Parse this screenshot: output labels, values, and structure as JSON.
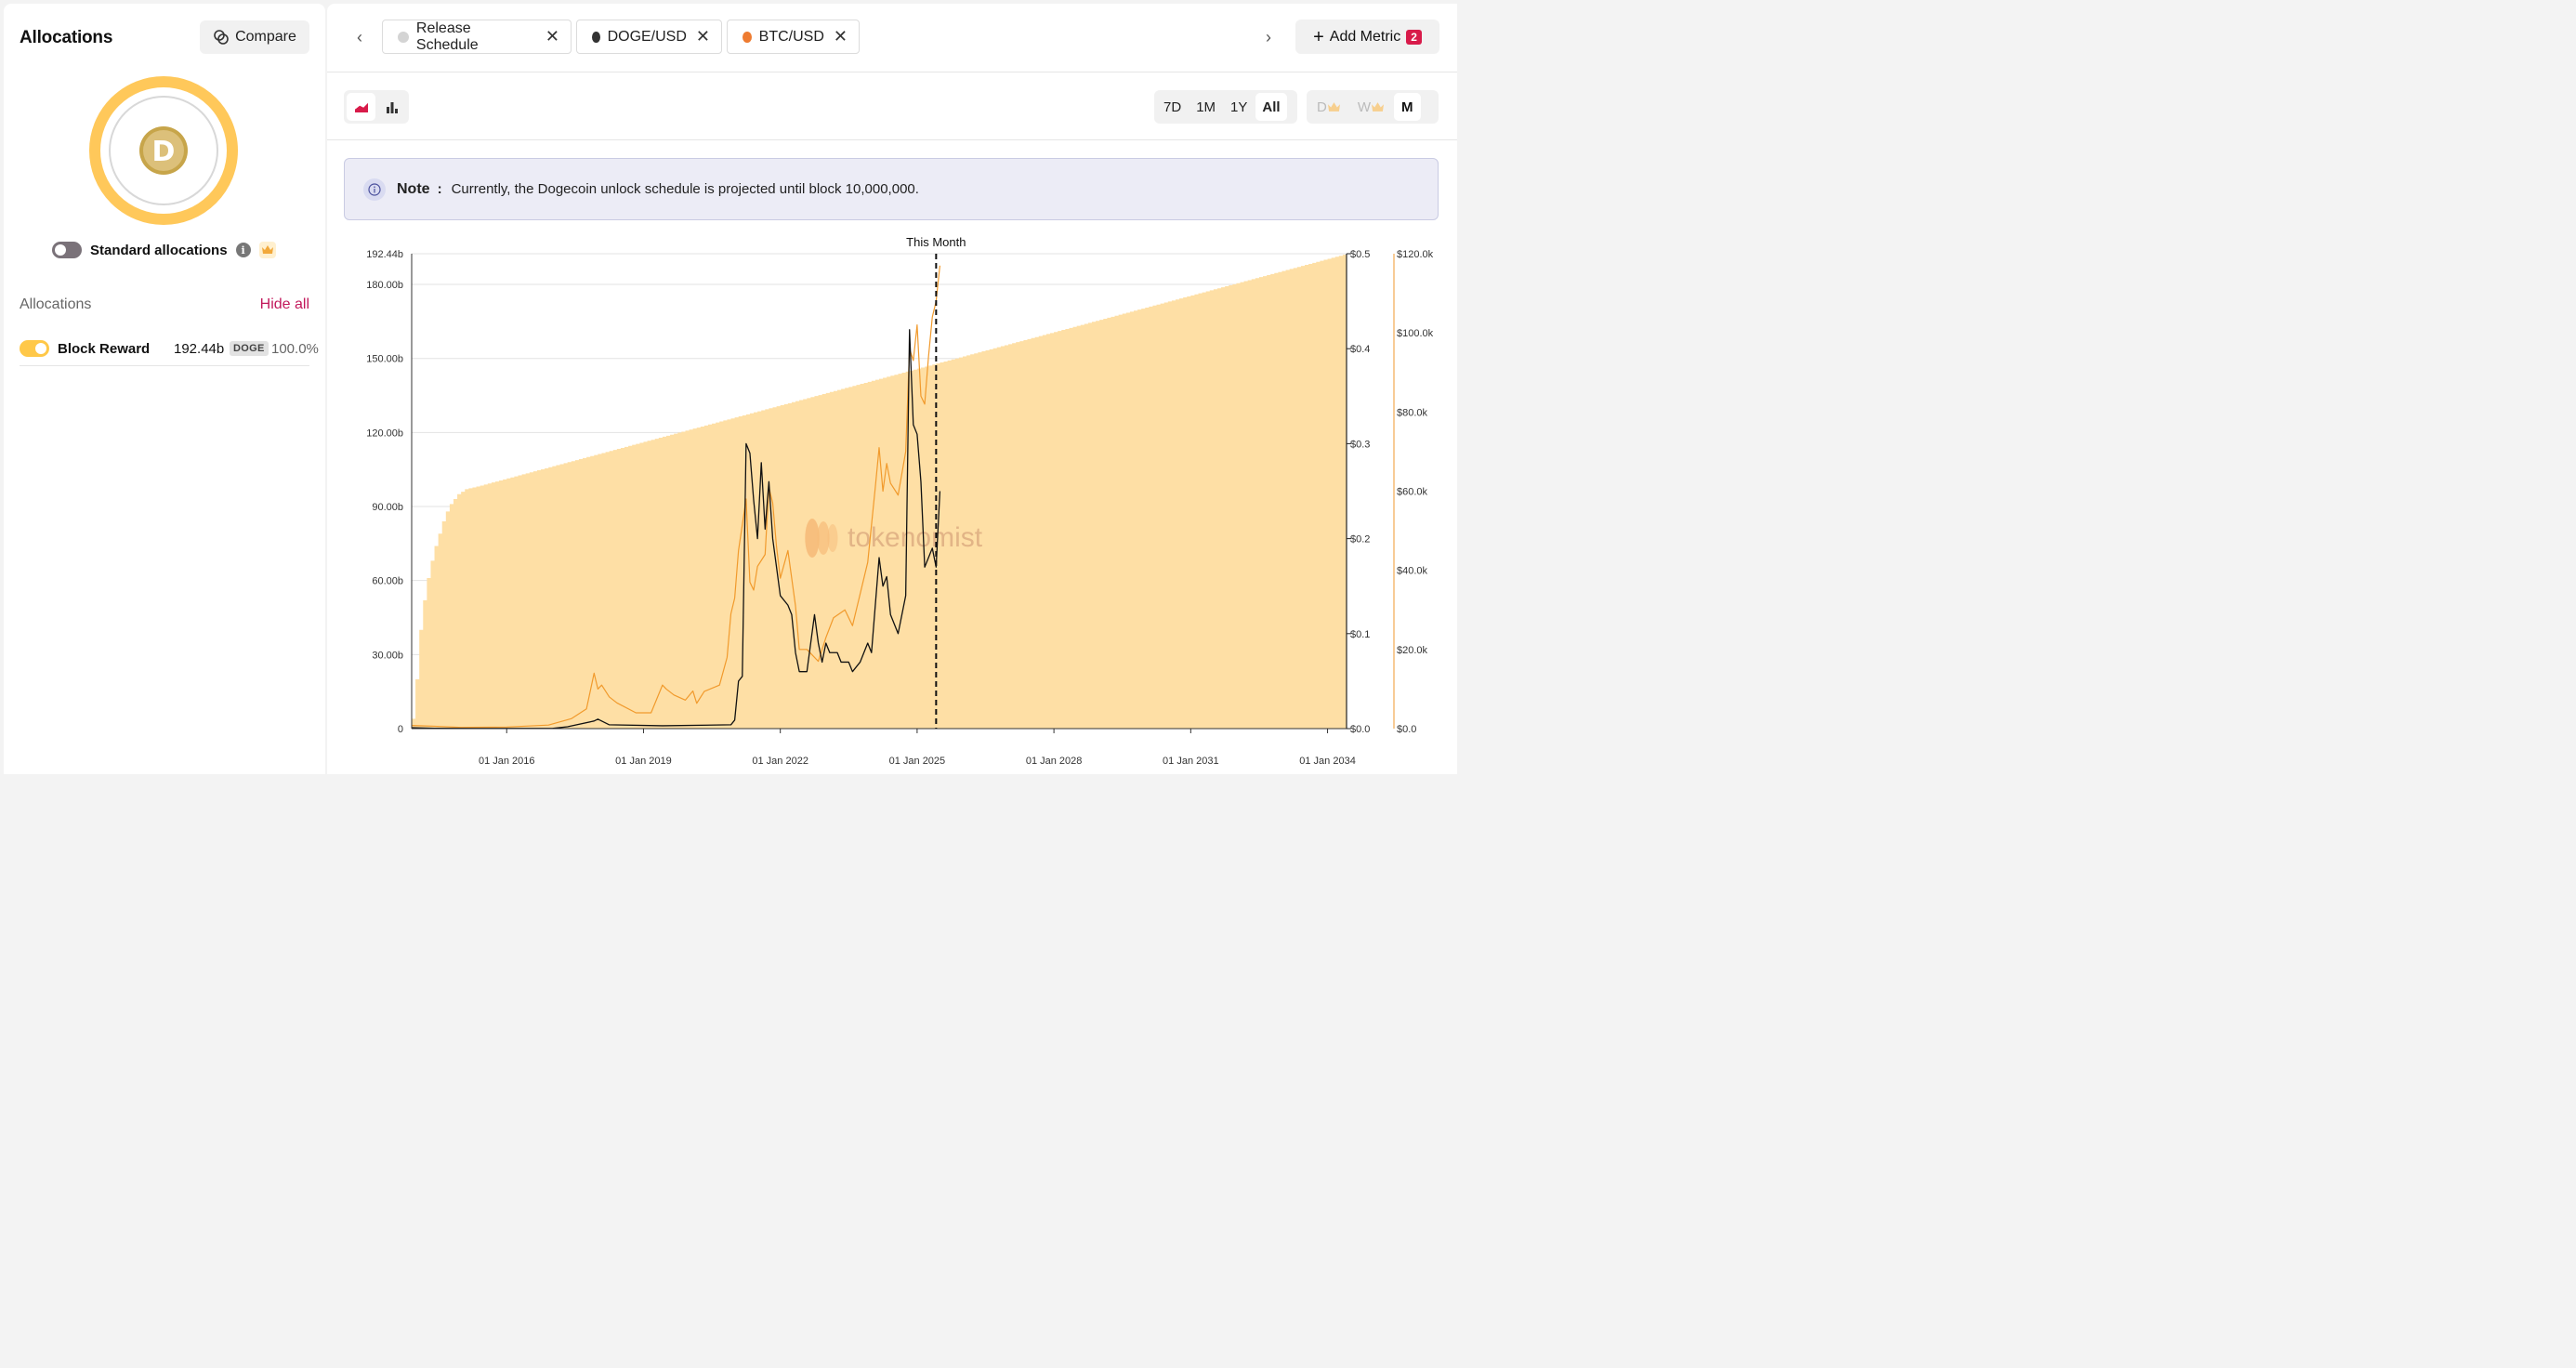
{
  "sidebar": {
    "title": "Allocations",
    "compare_label": "Compare",
    "token_logo_letter": "D",
    "standard_allocations_label": "Standard allocations",
    "allocations_label": "Allocations",
    "hide_all_label": "Hide all",
    "items": [
      {
        "name": "Block Reward",
        "amount": "192.44b",
        "symbol": "DOGE",
        "percent": "100.0%",
        "enabled": true
      }
    ]
  },
  "tabs": [
    {
      "label": "Release Schedule",
      "color": "#d4d4d4"
    },
    {
      "label": "DOGE/USD",
      "color": "#333333"
    },
    {
      "label": "BTC/USD",
      "color": "#ee7b30"
    }
  ],
  "add_metric": {
    "label": "Add Metric",
    "count": "2"
  },
  "ranges": [
    "7D",
    "1M",
    "1Y",
    "All"
  ],
  "active_range": "All",
  "granularity": [
    "D",
    "W",
    "M"
  ],
  "active_granularity": "M",
  "note": {
    "label": "Note",
    "text": "Currently, the Dogecoin unlock schedule is projected until block 10,000,000."
  },
  "watermark": "tokenomist",
  "colors": {
    "accent": "#c2185b",
    "supply_fill": "#fedfa5",
    "btc": "#f19a2c",
    "doge": "#111111"
  },
  "chart_data": {
    "type": "area",
    "marker_label": "This Month",
    "marker_date": "2025-06",
    "x_ticks": [
      "01 Jan 2016",
      "01 Jan 2019",
      "01 Jan 2022",
      "01 Jan 2025",
      "01 Jan 2028",
      "01 Jan 2031",
      "01 Jan 2034"
    ],
    "y_left": {
      "ticks": [
        "0",
        "30.00b",
        "60.00b",
        "90.00b",
        "120.00b",
        "150.00b",
        "180.00b",
        "192.44b"
      ],
      "values": [
        0,
        30,
        60,
        90,
        120,
        150,
        180,
        192.44
      ],
      "range": [
        0,
        192.44
      ],
      "unit": "b"
    },
    "y_right1": {
      "ticks": [
        "$0.0",
        "$0.1",
        "$0.2",
        "$0.3",
        "$0.4",
        "$0.5"
      ],
      "values": [
        0,
        0.1,
        0.2,
        0.3,
        0.4,
        0.5
      ],
      "range": [
        0,
        0.5
      ]
    },
    "y_right2": {
      "ticks": [
        "$0.0",
        "$20.0k",
        "$40.0k",
        "$60.0k",
        "$80.0k",
        "$100.0k",
        "$120.0k"
      ],
      "values": [
        0,
        20,
        40,
        60,
        80,
        100,
        120
      ],
      "range": [
        0,
        120
      ]
    },
    "series": [
      {
        "name": "Release Schedule",
        "axis": "left",
        "points": [
          [
            "2013-12",
            4
          ],
          [
            "2014-01",
            20
          ],
          [
            "2014-02",
            40
          ],
          [
            "2014-03",
            52
          ],
          [
            "2014-04",
            61
          ],
          [
            "2014-05",
            68
          ],
          [
            "2014-06",
            74
          ],
          [
            "2014-07",
            79
          ],
          [
            "2014-08",
            84
          ],
          [
            "2014-09",
            88
          ],
          [
            "2014-10",
            91
          ],
          [
            "2014-11",
            93
          ],
          [
            "2014-12",
            95
          ],
          [
            "2015-02",
            97
          ],
          [
            "2015-06",
            98.5
          ],
          [
            "2034-06",
            192.44
          ]
        ]
      },
      {
        "name": "DOGE/USD",
        "axis": "right1",
        "points": [
          [
            "2013-12",
            0.001
          ],
          [
            "2014-06",
            0.0004
          ],
          [
            "2015-06",
            0.0002
          ],
          [
            "2017-01",
            0.0002
          ],
          [
            "2017-05",
            0.002
          ],
          [
            "2017-12",
            0.008
          ],
          [
            "2018-01",
            0.01
          ],
          [
            "2018-04",
            0.004
          ],
          [
            "2019-06",
            0.003
          ],
          [
            "2020-12",
            0.004
          ],
          [
            "2021-01",
            0.009
          ],
          [
            "2021-02",
            0.05
          ],
          [
            "2021-03",
            0.055
          ],
          [
            "2021-04",
            0.3
          ],
          [
            "2021-05",
            0.29
          ],
          [
            "2021-06",
            0.24
          ],
          [
            "2021-07",
            0.2
          ],
          [
            "2021-08",
            0.28
          ],
          [
            "2021-09",
            0.21
          ],
          [
            "2021-10",
            0.26
          ],
          [
            "2021-11",
            0.2
          ],
          [
            "2021-12",
            0.17
          ],
          [
            "2022-01",
            0.14
          ],
          [
            "2022-03",
            0.13
          ],
          [
            "2022-04",
            0.12
          ],
          [
            "2022-05",
            0.08
          ],
          [
            "2022-06",
            0.06
          ],
          [
            "2022-08",
            0.06
          ],
          [
            "2022-10",
            0.12
          ],
          [
            "2022-11",
            0.09
          ],
          [
            "2022-12",
            0.07
          ],
          [
            "2023-01",
            0.09
          ],
          [
            "2023-02",
            0.08
          ],
          [
            "2023-04",
            0.08
          ],
          [
            "2023-05",
            0.07
          ],
          [
            "2023-07",
            0.07
          ],
          [
            "2023-08",
            0.06
          ],
          [
            "2023-10",
            0.07
          ],
          [
            "2023-12",
            0.09
          ],
          [
            "2024-01",
            0.08
          ],
          [
            "2024-03",
            0.18
          ],
          [
            "2024-04",
            0.15
          ],
          [
            "2024-05",
            0.16
          ],
          [
            "2024-06",
            0.12
          ],
          [
            "2024-08",
            0.1
          ],
          [
            "2024-10",
            0.14
          ],
          [
            "2024-11",
            0.42
          ],
          [
            "2024-12",
            0.32
          ],
          [
            "2025-01",
            0.31
          ],
          [
            "2025-02",
            0.26
          ],
          [
            "2025-03",
            0.17
          ],
          [
            "2025-04",
            0.18
          ],
          [
            "2025-05",
            0.19
          ],
          [
            "2025-06",
            0.17
          ],
          [
            "2025-07",
            0.25
          ]
        ]
      },
      {
        "name": "BTC/USD",
        "axis": "right2",
        "points": [
          [
            "2013-12",
            0.8
          ],
          [
            "2014-06",
            0.6
          ],
          [
            "2015-01",
            0.3
          ],
          [
            "2016-01",
            0.4
          ],
          [
            "2016-12",
            0.9
          ],
          [
            "2017-06",
            2.5
          ],
          [
            "2017-10",
            5
          ],
          [
            "2017-12",
            14
          ],
          [
            "2018-01",
            10
          ],
          [
            "2018-02",
            11
          ],
          [
            "2018-04",
            8
          ],
          [
            "2018-06",
            6.5
          ],
          [
            "2018-11",
            4
          ],
          [
            "2019-03",
            4
          ],
          [
            "2019-06",
            11
          ],
          [
            "2019-07",
            10
          ],
          [
            "2019-09",
            8.5
          ],
          [
            "2019-12",
            7.2
          ],
          [
            "2020-02",
            9.5
          ],
          [
            "2020-03",
            6.4
          ],
          [
            "2020-05",
            9.4
          ],
          [
            "2020-09",
            11
          ],
          [
            "2020-11",
            18
          ],
          [
            "2020-12",
            29
          ],
          [
            "2021-01",
            33
          ],
          [
            "2021-02",
            45
          ],
          [
            "2021-04",
            58
          ],
          [
            "2021-05",
            37
          ],
          [
            "2021-06",
            35
          ],
          [
            "2021-07",
            41
          ],
          [
            "2021-09",
            44
          ],
          [
            "2021-10",
            61
          ],
          [
            "2021-11",
            57
          ],
          [
            "2021-12",
            46
          ],
          [
            "2022-01",
            38
          ],
          [
            "2022-03",
            45
          ],
          [
            "2022-05",
            31
          ],
          [
            "2022-06",
            20
          ],
          [
            "2022-08",
            20
          ],
          [
            "2022-11",
            17
          ],
          [
            "2023-01",
            23
          ],
          [
            "2023-03",
            28
          ],
          [
            "2023-06",
            30
          ],
          [
            "2023-08",
            26
          ],
          [
            "2023-10",
            34
          ],
          [
            "2023-12",
            42
          ],
          [
            "2024-02",
            61
          ],
          [
            "2024-03",
            71
          ],
          [
            "2024-04",
            60
          ],
          [
            "2024-05",
            67
          ],
          [
            "2024-06",
            62
          ],
          [
            "2024-08",
            59
          ],
          [
            "2024-10",
            70
          ],
          [
            "2024-11",
            96
          ],
          [
            "2024-12",
            93
          ],
          [
            "2025-01",
            102
          ],
          [
            "2025-02",
            84
          ],
          [
            "2025-03",
            82
          ],
          [
            "2025-04",
            94
          ],
          [
            "2025-05",
            104
          ],
          [
            "2025-06",
            108
          ],
          [
            "2025-07",
            117
          ]
        ]
      }
    ]
  }
}
